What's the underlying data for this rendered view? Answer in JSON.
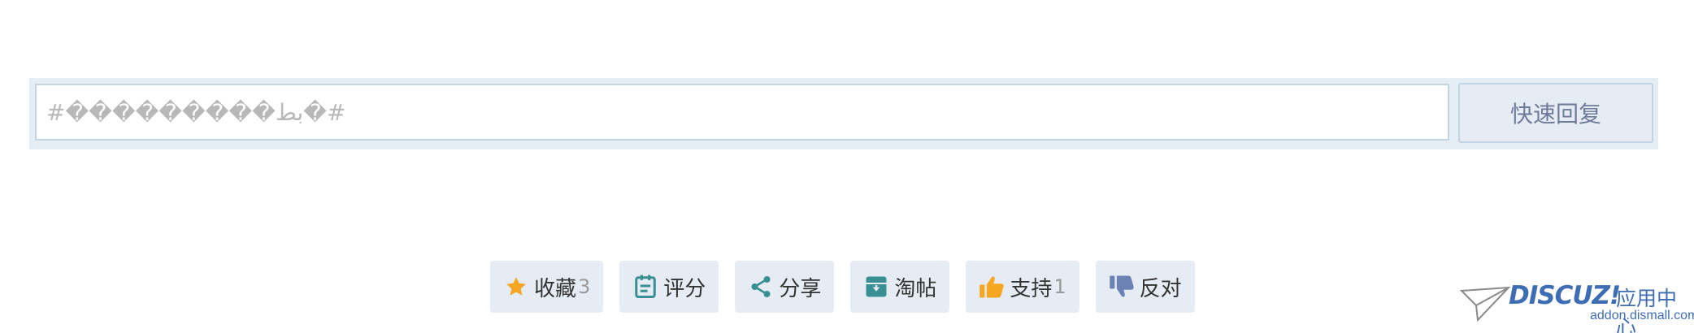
{
  "reply": {
    "placeholder": "#���������بط�#",
    "button_label": "快速回复"
  },
  "actions": [
    {
      "label": "收藏",
      "count": "3",
      "icon": "star-icon"
    },
    {
      "label": "评分",
      "count": "",
      "icon": "rate-icon"
    },
    {
      "label": "分享",
      "count": "",
      "icon": "share-icon"
    },
    {
      "label": "淘帖",
      "count": "",
      "icon": "archive-icon"
    },
    {
      "label": "支持",
      "count": "1",
      "icon": "thumbs-up-icon"
    },
    {
      "label": "反对",
      "count": "",
      "icon": "thumbs-down-icon"
    }
  ],
  "logo": {
    "wordmark": "DISCUZ!",
    "app_center": "应用中心",
    "domain": "addon.dismall.com"
  },
  "colors": {
    "star": "#f5a623",
    "teal_icon": "#3a8f93",
    "thumbs_up": "#f5a623",
    "thumbs_down": "#6c82b4",
    "logo_blue": "#3f6db3"
  }
}
